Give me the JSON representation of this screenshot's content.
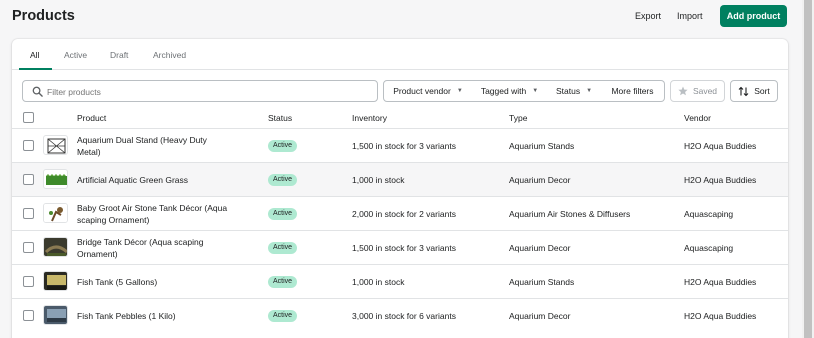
{
  "header": {
    "title": "Products",
    "export_label": "Export",
    "import_label": "Import",
    "add_label": "Add product",
    "accent": "#008060"
  },
  "tabs": [
    {
      "label": "All"
    },
    {
      "label": "Active"
    },
    {
      "label": "Draft"
    },
    {
      "label": "Archived"
    }
  ],
  "filters": {
    "search_placeholder": "Filter products",
    "vendor_label": "Product vendor",
    "tagged_label": "Tagged with",
    "status_label": "Status",
    "more_label": "More filters",
    "saved_label": "Saved",
    "sort_label": "Sort"
  },
  "columns": {
    "product": "Product",
    "status": "Status",
    "inventory": "Inventory",
    "type": "Type",
    "vendor": "Vendor"
  },
  "rows": [
    {
      "name_l1": "Aquarium Dual Stand (Heavy Duty",
      "name_l2": "Metal)",
      "status": "Active",
      "inventory": "1,500 in stock for 3 variants",
      "type": "Aquarium Stands",
      "vendor": "H2O Aqua Buddies",
      "thumb": "stand-icon"
    },
    {
      "name_l1": "Artificial Aquatic Green Grass",
      "name_l2": "",
      "status": "Active",
      "inventory": "1,000 in stock",
      "type": "Aquarium Decor",
      "vendor": "H2O Aqua Buddies",
      "thumb": "grass-icon"
    },
    {
      "name_l1": "Baby Groot Air Stone Tank Décor (Aqua",
      "name_l2": "scaping Ornament)",
      "status": "Active",
      "inventory": "2,000 in stock for 2 variants",
      "type": "Aquarium Air Stones & Diffusers",
      "vendor": "Aquascaping",
      "thumb": "groot-icon"
    },
    {
      "name_l1": "Bridge Tank Décor (Aqua scaping",
      "name_l2": "Ornament)",
      "status": "Active",
      "inventory": "1,500 in stock for 3 variants",
      "type": "Aquarium Decor",
      "vendor": "Aquascaping",
      "thumb": "bridge-icon"
    },
    {
      "name_l1": "Fish Tank (5 Gallons)",
      "name_l2": "",
      "status": "Active",
      "inventory": "1,000 in stock",
      "type": "Aquarium Stands",
      "vendor": "H2O Aqua Buddies",
      "thumb": "tank-icon"
    },
    {
      "name_l1": "Fish Tank Pebbles (1 Kilo)",
      "name_l2": "",
      "status": "Active",
      "inventory": "3,000 in stock for 6 variants",
      "type": "Aquarium Decor",
      "vendor": "H2O Aqua Buddies",
      "thumb": "pebbles-icon"
    }
  ]
}
